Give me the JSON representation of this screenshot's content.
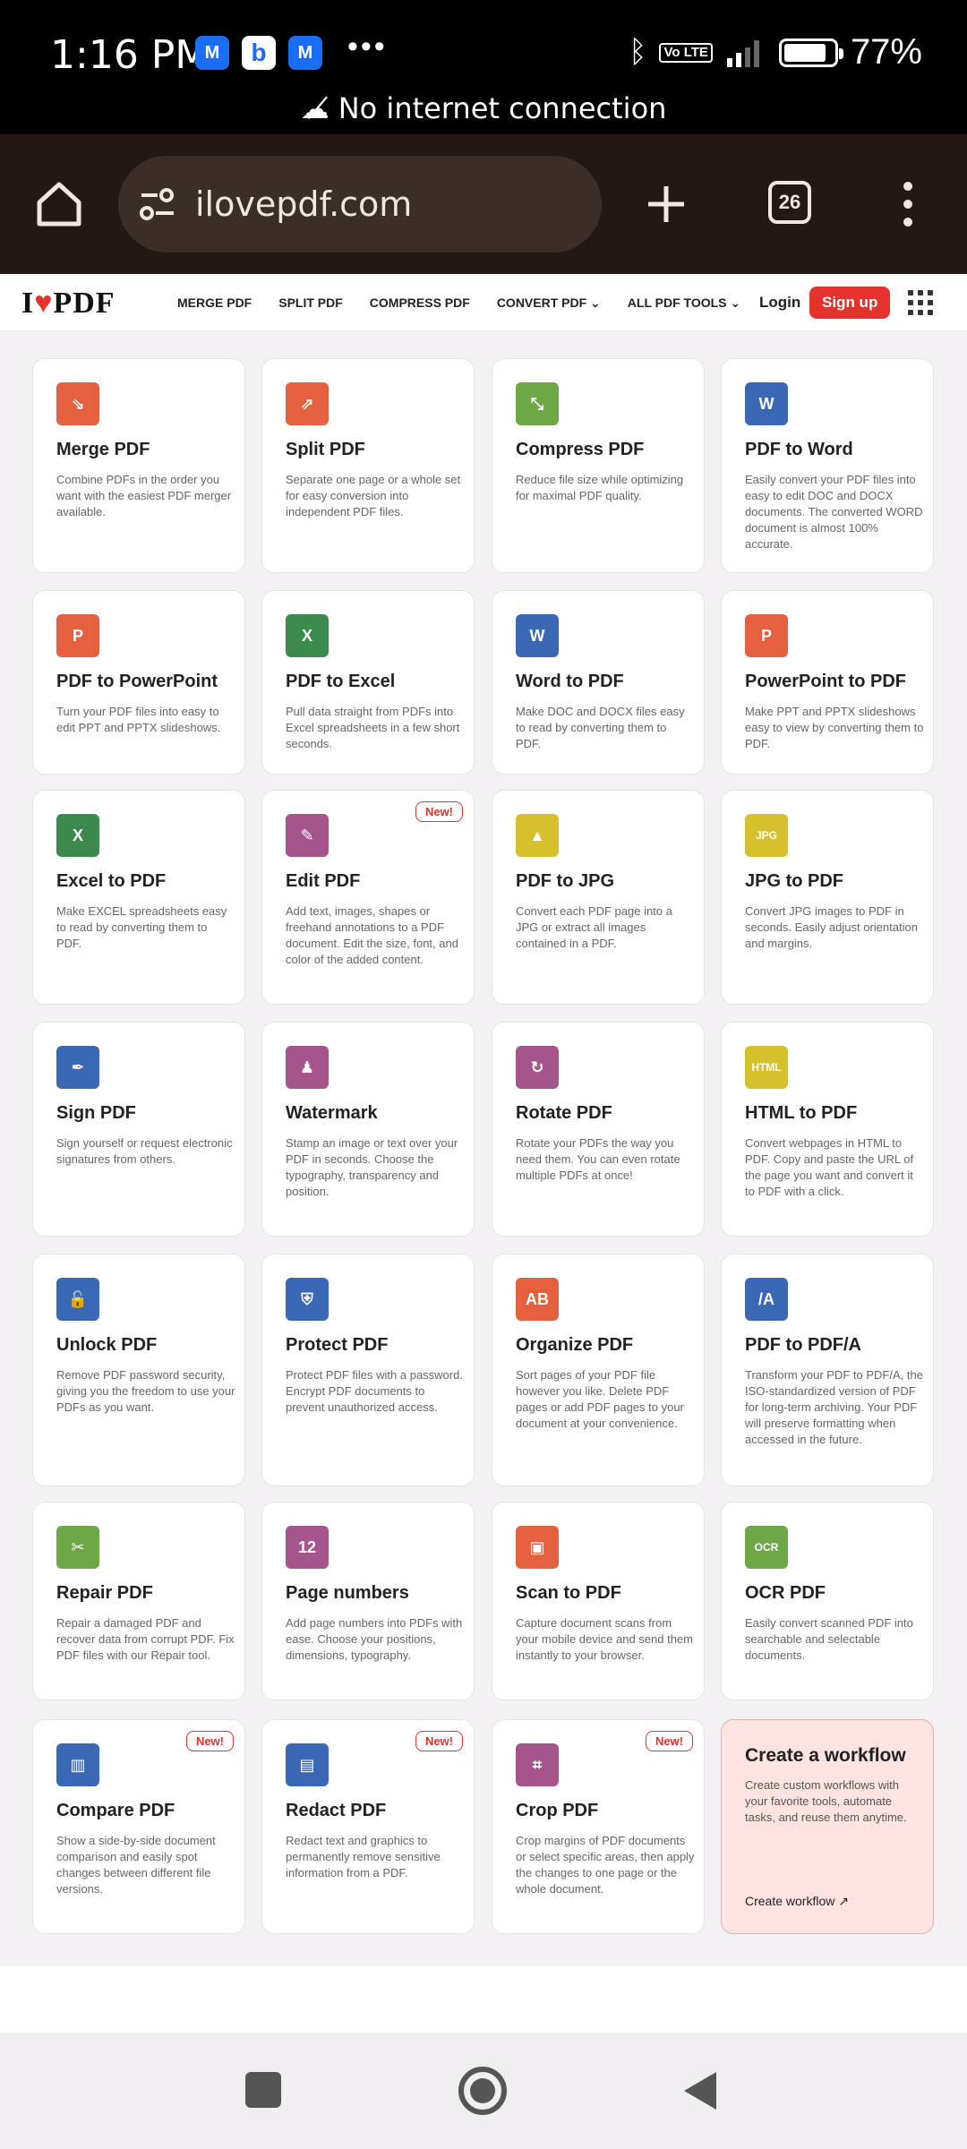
{
  "status": {
    "time": "1:16 PM",
    "no_internet": "No internet connection",
    "battery": "77%",
    "volte": "Vo LTE",
    "apps": [
      "mail-icon",
      "bing-icon",
      "mail-icon"
    ]
  },
  "browser": {
    "url": "ilovepdf.com",
    "tabs_count": "26"
  },
  "nav": {
    "logo_pre": "I",
    "logo_post": "PDF",
    "menu": [
      "MERGE PDF",
      "SPLIT PDF",
      "COMPRESS PDF",
      "CONVERT PDF",
      "ALL PDF TOOLS"
    ],
    "login": "Login",
    "signup": "Sign up"
  },
  "cards": [
    {
      "title": "Merge PDF",
      "desc": "Combine PDFs in the order you want with the easiest PDF merger available.",
      "color": "#e5603f",
      "glyph": "⇘",
      "new": false
    },
    {
      "title": "Split PDF",
      "desc": "Separate one page or a whole set for easy conversion into independent PDF files.",
      "color": "#e5603f",
      "glyph": "⇗",
      "new": false
    },
    {
      "title": "Compress PDF",
      "desc": "Reduce file size while optimizing for maximal PDF quality.",
      "color": "#6ea846",
      "glyph": "⤡",
      "new": false
    },
    {
      "title": "PDF to Word",
      "desc": "Easily convert your PDF files into easy to edit DOC and DOCX documents. The converted WORD document is almost 100% accurate.",
      "color": "#3a68b5",
      "glyph": "W",
      "new": false
    },
    {
      "title": "PDF to PowerPoint",
      "desc": "Turn your PDF files into easy to edit PPT and PPTX slideshows.",
      "color": "#e5603f",
      "glyph": "P",
      "new": false
    },
    {
      "title": "PDF to Excel",
      "desc": "Pull data straight from PDFs into Excel spreadsheets in a few short seconds.",
      "color": "#3d8a4e",
      "glyph": "X",
      "new": false
    },
    {
      "title": "Word to PDF",
      "desc": "Make DOC and DOCX files easy to read by converting them to PDF.",
      "color": "#3a68b5",
      "glyph": "W",
      "new": false
    },
    {
      "title": "PowerPoint to PDF",
      "desc": "Make PPT and PPTX slideshows easy to view by converting them to PDF.",
      "color": "#e5603f",
      "glyph": "P",
      "new": false
    },
    {
      "title": "Excel to PDF",
      "desc": "Make EXCEL spreadsheets easy to read by converting them to PDF.",
      "color": "#3d8a4e",
      "glyph": "X",
      "new": false
    },
    {
      "title": "Edit PDF",
      "desc": "Add text, images, shapes or freehand annotations to a PDF document. Edit the size, font, and color of the added content.",
      "color": "#a5548c",
      "glyph": "✎",
      "new": true
    },
    {
      "title": "PDF to JPG",
      "desc": "Convert each PDF page into a JPG or extract all images contained in a PDF.",
      "color": "#d6c02c",
      "glyph": "▲",
      "new": false
    },
    {
      "title": "JPG to PDF",
      "desc": "Convert JPG images to PDF in seconds. Easily adjust orientation and margins.",
      "color": "#d6c02c",
      "glyph": "JPG",
      "new": false
    },
    {
      "title": "Sign PDF",
      "desc": "Sign yourself or request electronic signatures from others.",
      "color": "#3a68b5",
      "glyph": "✒",
      "new": false
    },
    {
      "title": "Watermark",
      "desc": "Stamp an image or text over your PDF in seconds. Choose the typography, transparency and position.",
      "color": "#a5548c",
      "glyph": "♟",
      "new": false
    },
    {
      "title": "Rotate PDF",
      "desc": "Rotate your PDFs the way you need them. You can even rotate multiple PDFs at once!",
      "color": "#a5548c",
      "glyph": "↻",
      "new": false
    },
    {
      "title": "HTML to PDF",
      "desc": "Convert webpages in HTML to PDF. Copy and paste the URL of the page you want and convert it to PDF with a click.",
      "color": "#d6c02c",
      "glyph": "HTML",
      "new": false
    },
    {
      "title": "Unlock PDF",
      "desc": "Remove PDF password security, giving you the freedom to use your PDFs as you want.",
      "color": "#3a68b5",
      "glyph": "🔓",
      "new": false
    },
    {
      "title": "Protect PDF",
      "desc": "Protect PDF files with a password. Encrypt PDF documents to prevent unauthorized access.",
      "color": "#3a68b5",
      "glyph": "⛨",
      "new": false
    },
    {
      "title": "Organize PDF",
      "desc": "Sort pages of your PDF file however you like. Delete PDF pages or add PDF pages to your document at your convenience.",
      "color": "#e5603f",
      "glyph": "AB",
      "new": false
    },
    {
      "title": "PDF to PDF/A",
      "desc": "Transform your PDF to PDF/A, the ISO-standardized version of PDF for long-term archiving. Your PDF will preserve formatting when accessed in the future.",
      "color": "#3a68b5",
      "glyph": "/A",
      "new": false
    },
    {
      "title": "Repair PDF",
      "desc": "Repair a damaged PDF and recover data from corrupt PDF. Fix PDF files with our Repair tool.",
      "color": "#6ea846",
      "glyph": "✂",
      "new": false
    },
    {
      "title": "Page numbers",
      "desc": "Add page numbers into PDFs with ease. Choose your positions, dimensions, typography.",
      "color": "#a5548c",
      "glyph": "12",
      "new": false
    },
    {
      "title": "Scan to PDF",
      "desc": "Capture document scans from your mobile device and send them instantly to your browser.",
      "color": "#e5603f",
      "glyph": "▣",
      "new": false
    },
    {
      "title": "OCR PDF",
      "desc": "Easily convert scanned PDF into searchable and selectable documents.",
      "color": "#6ea846",
      "glyph": "OCR",
      "new": false
    },
    {
      "title": "Compare PDF",
      "desc": "Show a side-by-side document comparison and easily spot changes between different file versions.",
      "color": "#3a68b5",
      "glyph": "▥",
      "new": true
    },
    {
      "title": "Redact PDF",
      "desc": "Redact text and graphics to permanently remove sensitive information from a PDF.",
      "color": "#3a68b5",
      "glyph": "▤",
      "new": true
    },
    {
      "title": "Crop PDF",
      "desc": "Crop margins of PDF documents or select specific areas, then apply the changes to one page or the whole document.",
      "color": "#a5548c",
      "glyph": "⌗",
      "new": true
    }
  ],
  "new_label": "New!",
  "workflow": {
    "title": "Create a workflow",
    "desc": "Create custom workflows with your favorite tools, automate tasks, and reuse them anytime.",
    "link": "Create workflow"
  }
}
